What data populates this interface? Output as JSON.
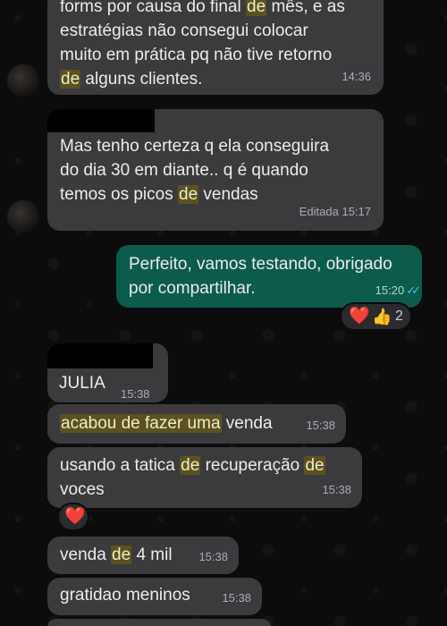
{
  "messages": [
    {
      "line1_pre": "forms por causa do final ",
      "line1_hl": "de",
      "line1_post": " mês, e as",
      "line2": "estratégias não consegui colocar",
      "line3": "muito em prática pq não tive retorno",
      "line4_hl": "de",
      "line4_post": " alguns clientes.",
      "time": "14:36"
    },
    {
      "line1": "Mas tenho certeza q ela conseguira",
      "line2": "do dia 30 em diante.. q é quando",
      "line3_pre": "temos os picos ",
      "line3_hl": "de",
      "line3_post": " vendas",
      "time": "Editada 15:17"
    },
    {
      "line1": "Perfeito, vamos testando, obrigado",
      "line2": "por compartilhar.",
      "time": "15:20",
      "reactions": {
        "heart": "❤️",
        "thumb": "👍",
        "count": "2"
      }
    },
    {
      "text": "JULIA",
      "time": "15:38"
    },
    {
      "pre": "",
      "hl": "acabou de fazer uma",
      "post": " venda",
      "time": "15:38"
    },
    {
      "line1_pre": "usando a tatica ",
      "line1_hl1": "de",
      "line1_mid": " recuperação ",
      "line1_hl2": "de",
      "line2": "voces",
      "time": "15:38",
      "reaction": "❤️"
    },
    {
      "pre": "venda ",
      "hl": "de",
      "post": " 4 mil",
      "time": "15:38"
    },
    {
      "text": "gratidao meninos",
      "time": "15:38"
    }
  ],
  "colors": {
    "incoming_bubble": "#3b3b3d",
    "outgoing_bubble": "#0d5c4b",
    "read_ticks": "#53bdeb",
    "search_highlight": "#5b5221"
  }
}
